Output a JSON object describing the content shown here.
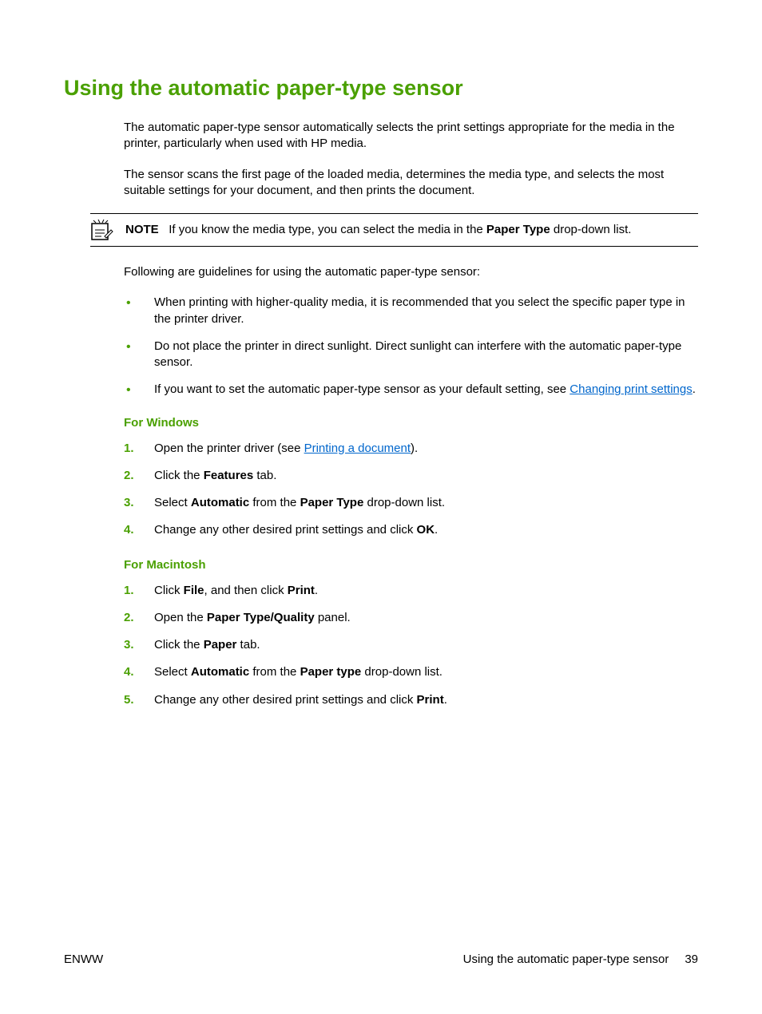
{
  "title": "Using the automatic paper-type sensor",
  "intro_p1": "The automatic paper-type sensor automatically selects the print settings appropriate for the media in the printer, particularly when used with HP media.",
  "intro_p2": "The sensor scans the first page of the loaded media, determines the media type, and selects the most suitable settings for your document, and then prints the document.",
  "note": {
    "label": "NOTE",
    "text_before": "If you know the media type, you can select the media in the ",
    "bold": "Paper Type",
    "text_after": " drop-down list."
  },
  "guidelines_intro": "Following are guidelines for using the automatic paper-type sensor:",
  "bullets": [
    {
      "text": "When printing with higher-quality media, it is recommended that you select the specific paper type in the printer driver."
    },
    {
      "text": "Do not place the printer in direct sunlight. Direct sunlight can interfere with the automatic paper-type sensor."
    },
    {
      "text_before": "If you want to set the automatic paper-type sensor as your default setting, see ",
      "link": "Changing print settings",
      "text_after": "."
    }
  ],
  "windows": {
    "heading": "For Windows",
    "steps": [
      {
        "text_before": "Open the printer driver (see ",
        "link": "Printing a document",
        "text_after": ")."
      },
      {
        "parts": [
          {
            "t": "Click the "
          },
          {
            "b": "Features"
          },
          {
            "t": " tab."
          }
        ]
      },
      {
        "parts": [
          {
            "t": "Select "
          },
          {
            "b": "Automatic"
          },
          {
            "t": " from the "
          },
          {
            "b": "Paper Type"
          },
          {
            "t": " drop-down list."
          }
        ]
      },
      {
        "parts": [
          {
            "t": "Change any other desired print settings and click "
          },
          {
            "b": "OK"
          },
          {
            "t": "."
          }
        ]
      }
    ]
  },
  "mac": {
    "heading": "For Macintosh",
    "steps": [
      {
        "parts": [
          {
            "t": "Click "
          },
          {
            "b": "File"
          },
          {
            "t": ", and then click "
          },
          {
            "b": "Print"
          },
          {
            "t": "."
          }
        ]
      },
      {
        "parts": [
          {
            "t": "Open the "
          },
          {
            "b": "Paper Type/Quality"
          },
          {
            "t": " panel."
          }
        ]
      },
      {
        "parts": [
          {
            "t": "Click the "
          },
          {
            "b": "Paper"
          },
          {
            "t": " tab."
          }
        ]
      },
      {
        "parts": [
          {
            "t": "Select "
          },
          {
            "b": "Automatic"
          },
          {
            "t": " from the "
          },
          {
            "b": "Paper type"
          },
          {
            "t": " drop-down list."
          }
        ]
      },
      {
        "parts": [
          {
            "t": "Change any other desired print settings and click "
          },
          {
            "b": "Print"
          },
          {
            "t": "."
          }
        ]
      }
    ]
  },
  "footer": {
    "left": "ENWW",
    "right_text": "Using the automatic paper-type sensor",
    "page": "39"
  }
}
